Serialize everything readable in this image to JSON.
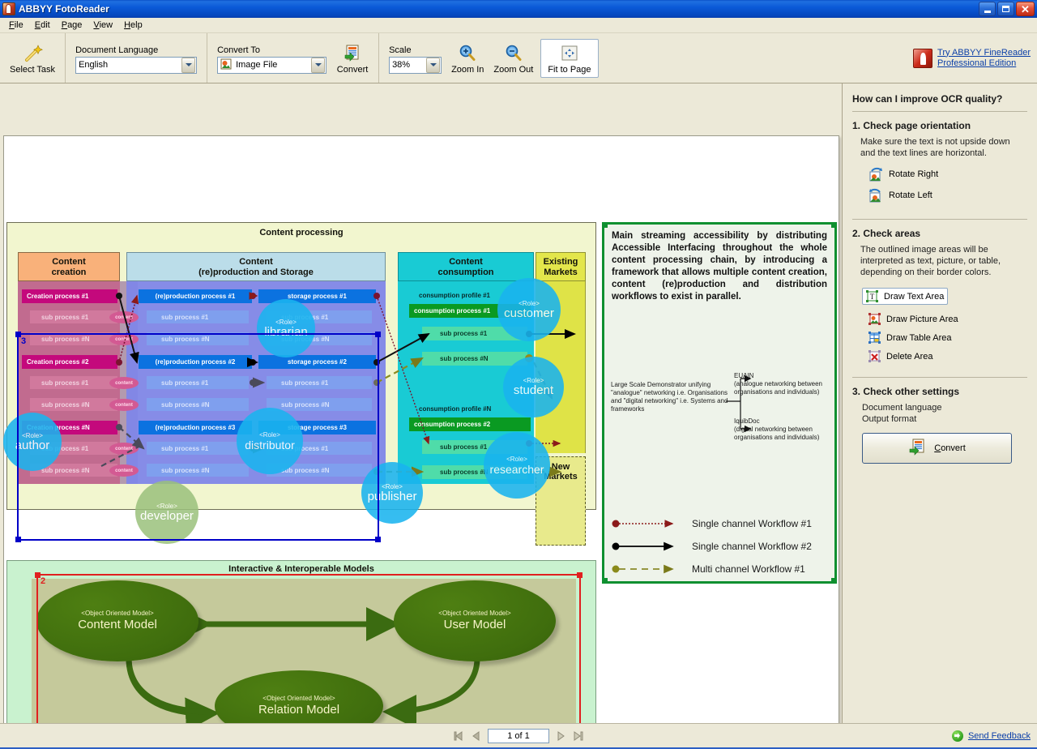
{
  "window": {
    "title": "ABBYY FotoReader",
    "app_icon": "abbyy-logo-icon",
    "minimize": "minimize-icon",
    "maximize": "restore-icon",
    "close": "close-icon"
  },
  "menu": {
    "items": [
      "File",
      "Edit",
      "Page",
      "View",
      "Help"
    ]
  },
  "toolbar": {
    "select_task_label": "Select Task",
    "select_task_icon": "magic-wand-icon",
    "document_language_label": "Document Language",
    "document_language_value": "English",
    "convert_to_label": "Convert To",
    "convert_to_value": "Image File",
    "convert_label": "Convert",
    "convert_icon": "convert-document-icon",
    "scale_label": "Scale",
    "scale_value": "38%",
    "zoom_in_label": "Zoom In",
    "zoom_out_label": "Zoom Out",
    "fit_to_page_label": "Fit to Page",
    "promo_line1": "Try ABBYY FineReader",
    "promo_line2": "Professional Edition"
  },
  "sidebar": {
    "title": "How can I improve OCR quality?",
    "step1_title": "1. Check page orientation",
    "step1_desc": "Make sure the text is not upside down and the text lines are horizontal.",
    "rotate_right": "Rotate Right",
    "rotate_left": "Rotate Left",
    "step2_title": "2. Check areas",
    "step2_desc": "The outlined image areas will be interpreted as text, picture, or table, depending on their border colors.",
    "draw_text_area": "Draw Text Area",
    "draw_picture_area": "Draw Picture Area",
    "draw_table_area": "Draw Table Area",
    "delete_area": "Delete Area",
    "step3_title": "3. Check other settings",
    "setting1": "Document language",
    "setting2": "Output format",
    "convert_button": "Convert"
  },
  "statusbar": {
    "first_page_icon": "first-page-icon",
    "prev_page_icon": "prev-page-icon",
    "page_value": "1 of 1",
    "next_page_icon": "next-page-icon",
    "last_page_icon": "last-page-icon",
    "feedback_label": "Send Feedback"
  },
  "document": {
    "areas": {
      "area3_number": "3",
      "area2_number": "2",
      "area3_color": "#0000c8",
      "area2_color": "#e02020",
      "text_area_color": "#0f9030"
    },
    "content_processing": {
      "title": "Content processing",
      "columns": [
        {
          "label": "Content\ncreation",
          "color": "#f9b17a"
        },
        {
          "label": "Content\n(re)production and Storage",
          "color": "#bbdde9"
        },
        {
          "label": "Content\nconsumption",
          "color": "#19cbd4"
        },
        {
          "label": "Existing\nMarkets",
          "color": "#e3e64b"
        }
      ],
      "new_markets": "New\nMarkets",
      "creation_processes": [
        "Creation process #1",
        "sub process #1",
        "sub process #N",
        "Creation process #2",
        "sub process #1",
        "sub process #N",
        "Creation process #N",
        "sub process #1",
        "sub process #N"
      ],
      "content_pills": [
        "content",
        "content",
        "content",
        "content",
        "content",
        "content"
      ],
      "production_processes": [
        "(re)production  process #1",
        "sub process #1",
        "sub process #N",
        "(re)production  process #2",
        "sub process #1",
        "sub process #N",
        "(re)production  process #3",
        "sub process #1",
        "sub process #N"
      ],
      "storage_processes": [
        "storage  process #1",
        "sub process #1",
        "sub process #N",
        "storage  process #2",
        "sub process #1",
        "sub process #N",
        "storage  process #3",
        "sub process #1",
        "sub process #N"
      ],
      "consumption_group_1": [
        "consumption  profile #1",
        "consumption  process #1",
        "sub process #1",
        "sub process #N"
      ],
      "consumption_group_2": [
        "consumption  profile #N",
        "consumption  process #2",
        "sub process #1",
        "sub process #N"
      ],
      "roles": [
        {
          "tag": "<Role>",
          "name": "librarian",
          "color": "#1ab4ef"
        },
        {
          "tag": "<Role>",
          "name": "author",
          "color": "#1ab4ef"
        },
        {
          "tag": "<Role>",
          "name": "distributor",
          "color": "#1ab4ef"
        },
        {
          "tag": "<Role>",
          "name": "publisher",
          "color": "#1ab4ef"
        },
        {
          "tag": "<Role>",
          "name": "developer",
          "color": "#9bc17c"
        },
        {
          "tag": "<Role>",
          "name": "customer",
          "color": "#1ab4ef"
        },
        {
          "tag": "<Role>",
          "name": "student",
          "color": "#1ab4ef"
        },
        {
          "tag": "<Role>",
          "name": "researcher",
          "color": "#1ab4ef"
        }
      ]
    },
    "text_area": {
      "paragraph": "Main streaming accessibility by distributing Accessible Interfacing throughout the whole content processing chain, by introducing a framework that allows multiple content creation, content (re)production and distribution workflows to exist in parallel.",
      "lsd": "Large Scale Demonstrator unifying \"analogue\" networking i.e. Organisations and \"digital networking\" i.e. Systems and frameworks",
      "euain_title": "EUAIN",
      "euain_desc": "(analogue networking between organisations and individuals)",
      "iquib_title": "IquibDoc",
      "iquib_desc": "(digital networking between organisations and individuals)",
      "legend": [
        {
          "label": "Single channel Workflow #1",
          "color": "#8b1a1a",
          "style": "dotted"
        },
        {
          "label": "Single channel Workflow #2",
          "color": "#000000",
          "style": "solid"
        },
        {
          "label": "Multi channel Workflow #1",
          "color": "#7a7a1a",
          "style": "dashed"
        }
      ]
    },
    "models": {
      "title": "Interactive & Interoperable Models",
      "nodes": [
        {
          "tag": "<Object Oriented Model>",
          "name": "Content Model"
        },
        {
          "tag": "<Object Oriented Model>",
          "name": "User Model"
        },
        {
          "tag": "<Object Oriented Model>",
          "name": "Relation Model"
        }
      ]
    }
  }
}
